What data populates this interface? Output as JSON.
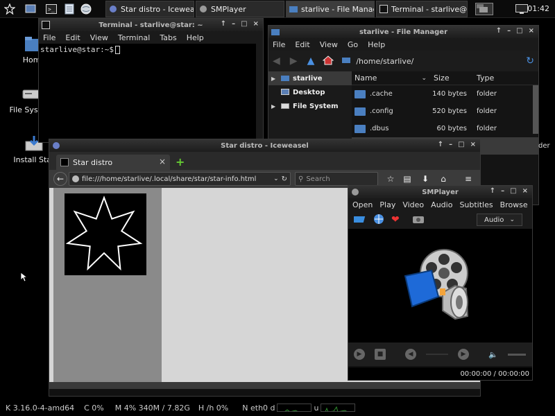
{
  "taskbar": {
    "tasks": [
      {
        "label": "Star distro - Iceweasel"
      },
      {
        "label": "SMPlayer"
      },
      {
        "label": "starlive - File Manager"
      },
      {
        "label": "Terminal - starlive@..."
      }
    ],
    "clock": "01:42"
  },
  "desktop": {
    "icons": [
      {
        "label": "Home"
      },
      {
        "label": "File System"
      },
      {
        "label": "Install Star"
      }
    ]
  },
  "terminal": {
    "title": "Terminal - starlive@star: ~",
    "menu": [
      "File",
      "Edit",
      "View",
      "Terminal",
      "Tabs",
      "Help"
    ],
    "prompt": "starlive@star:~$"
  },
  "filemanager": {
    "title": "starlive - File Manager",
    "menu": [
      "File",
      "Edit",
      "View",
      "Go",
      "Help"
    ],
    "path": "/home/starlive/",
    "sidebar": [
      {
        "label": "starlive"
      },
      {
        "label": "Desktop"
      },
      {
        "label": "File System"
      }
    ],
    "columns": {
      "name": "Name",
      "size": "Size",
      "type": "Type"
    },
    "rows": [
      {
        "name": ".cache",
        "size": "140 bytes",
        "type": "folder"
      },
      {
        "name": ".config",
        "size": "520 bytes",
        "type": "folder"
      },
      {
        "name": ".dbus",
        "size": "60 bytes",
        "type": "folder"
      },
      {
        "name": "",
        "size": "",
        "type": "der"
      }
    ]
  },
  "browser": {
    "title": "Star distro - Iceweasel",
    "tab_label": "Star distro",
    "url": "file:///home/starlive/.local/share/star/star-info.html",
    "search_placeholder": "Search"
  },
  "smplayer": {
    "title": "SMPlayer",
    "menu": [
      "Open",
      "Play",
      "Video",
      "Audio",
      "Subtitles",
      "Browse"
    ],
    "audio_select": "Audio",
    "time": "00:00:00 / 00:00:00"
  },
  "statusbar": {
    "kernel": "K 3.16.0-4-amd64",
    "cpu": "C 0%",
    "mem": "M 4%  340M / 7.82G",
    "hdd": "H /h 0%",
    "net": "N  eth0  d",
    "net_up": "u"
  },
  "colors": {
    "folder": "#4a7fc0",
    "graph": "#2f8f2f"
  }
}
